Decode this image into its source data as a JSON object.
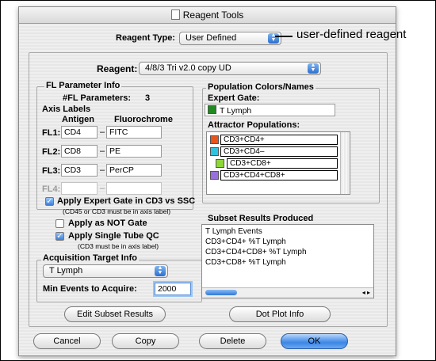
{
  "window": {
    "title": "Reagent Tools"
  },
  "callout": "user-defined reagent",
  "reagent_type": {
    "label": "Reagent Type:",
    "value": "User Defined"
  },
  "reagent": {
    "label": "Reagent:",
    "value": "4/8/3 Tri v2.0 copy UD"
  },
  "fl_param": {
    "title": "FL Parameter Info",
    "count_label": "#FL Parameters:",
    "count_value": "3",
    "axis_labels": "Axis Labels",
    "col_antigen": "Antigen",
    "col_fluoro": "Fluorochrome",
    "rows": [
      {
        "label": "FL1:",
        "antigen": "CD4",
        "dash": "–",
        "fluoro": "FITC"
      },
      {
        "label": "FL2:",
        "antigen": "CD8",
        "dash": "–",
        "fluoro": "PE"
      },
      {
        "label": "FL3:",
        "antigen": "CD3",
        "dash": "–",
        "fluoro": "PerCP"
      },
      {
        "label": "FL4:",
        "antigen": "",
        "dash": "–",
        "fluoro": ""
      }
    ]
  },
  "options": {
    "expert_gate": {
      "label": "Apply Expert Gate in CD3 vs SSC",
      "note": "(CD45 or CD3 must be in axis label)"
    },
    "not_gate": {
      "label": "Apply as NOT Gate"
    },
    "single_tube": {
      "label": "Apply Single Tube QC",
      "note": "(CD3 must be in axis label)"
    }
  },
  "acquisition": {
    "title": "Acquisition Target Info",
    "target": "T Lymph",
    "min_events_label": "Min Events to Acquire:",
    "min_events_value": "2000"
  },
  "population": {
    "title": "Population Colors/Names",
    "expert_gate_label": "Expert Gate:",
    "expert_gate_value": "T Lymph",
    "expert_gate_color": "#1f8a1f",
    "attractor_label": "Attractor Populations:",
    "attractors": [
      {
        "name": "CD3+CD4+",
        "color": "#e8541c"
      },
      {
        "name": "CD3+CD4–",
        "color": "#2fc3e0"
      },
      {
        "name": "CD3+CD8+",
        "color": "#8fd63a"
      },
      {
        "name": "CD3+CD4+CD8+",
        "color": "#9a6fe0"
      }
    ]
  },
  "subset": {
    "title": "Subset Results Produced",
    "items": [
      "T Lymph Events",
      "CD3+CD4+ %T Lymph",
      "CD3+CD4+CD8+ %T Lymph",
      "CD3+CD8+ %T Lymph"
    ]
  },
  "buttons": {
    "edit_subset": "Edit Subset Results",
    "dot_plot": "Dot Plot Info",
    "cancel": "Cancel",
    "copy": "Copy",
    "delete": "Delete",
    "ok": "OK"
  }
}
